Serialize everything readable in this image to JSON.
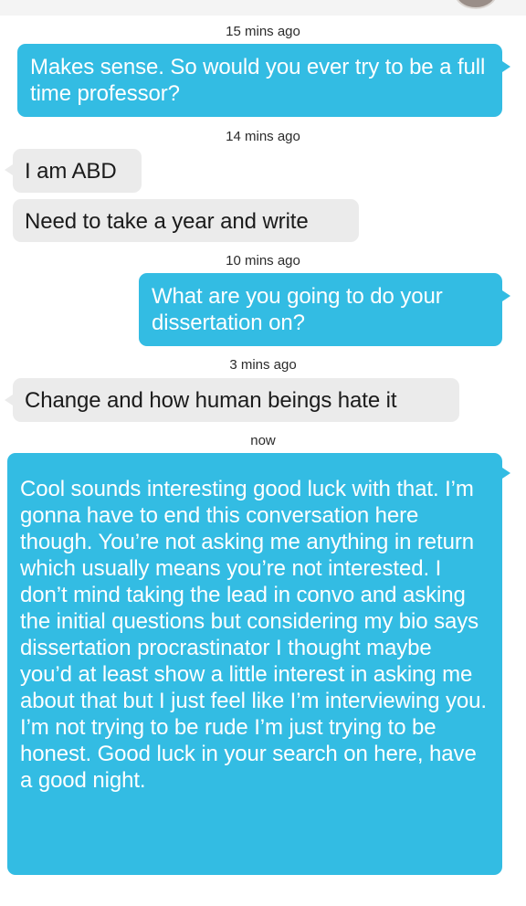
{
  "conversation": {
    "messages": [
      {
        "time": "15 mins ago",
        "sender": "me",
        "text": "Makes sense. So would you ever try to be a full time professor?"
      },
      {
        "time": "14 mins ago",
        "sender": "them",
        "text": "I am ABD"
      },
      {
        "sender": "them",
        "text": "Need to take a year and write"
      },
      {
        "time": "10 mins ago",
        "sender": "me",
        "text": "What are you going to do your dissertation on?"
      },
      {
        "time": "3 mins ago",
        "sender": "them",
        "text": "Change and how human beings hate it"
      },
      {
        "time": "now",
        "sender": "me",
        "text": "Cool sounds interesting good luck with that. I’m gonna have to end this conversation here though. You’re not asking me anything in return which usually means you’re not interested. I don’t mind taking the lead in convo and asking the initial questions but considering my bio says dissertation procrastinator I thought maybe you’d at least show a little interest in asking me about that but I just feel like I’m interviewing you. I’m not trying to be rude I’m just trying to be honest. Good luck in your search on here, have a good night."
      }
    ]
  },
  "colors": {
    "outgoing_bubble": "#33bce3",
    "incoming_bubble": "#ebebeb",
    "outgoing_text": "#ffffff",
    "incoming_text": "#1b1b1b"
  }
}
